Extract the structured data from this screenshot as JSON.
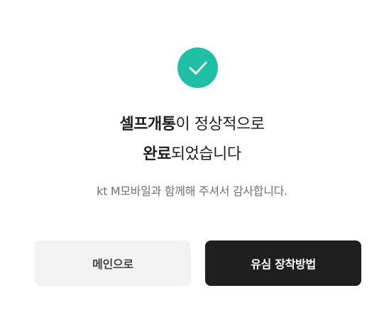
{
  "result": {
    "title_line1_bold": "셀프개통",
    "title_line1_rest": "이 정상적으로",
    "title_line2_bold": "완료",
    "title_line2_rest": "되었습니다",
    "message": "kt M모바일과 함께해 주셔서 감사합니다.",
    "icon": "check-icon",
    "accent_color": "#1fbfa6"
  },
  "buttons": {
    "main_label": "메인으로",
    "guide_label": "유심 장착방법"
  }
}
